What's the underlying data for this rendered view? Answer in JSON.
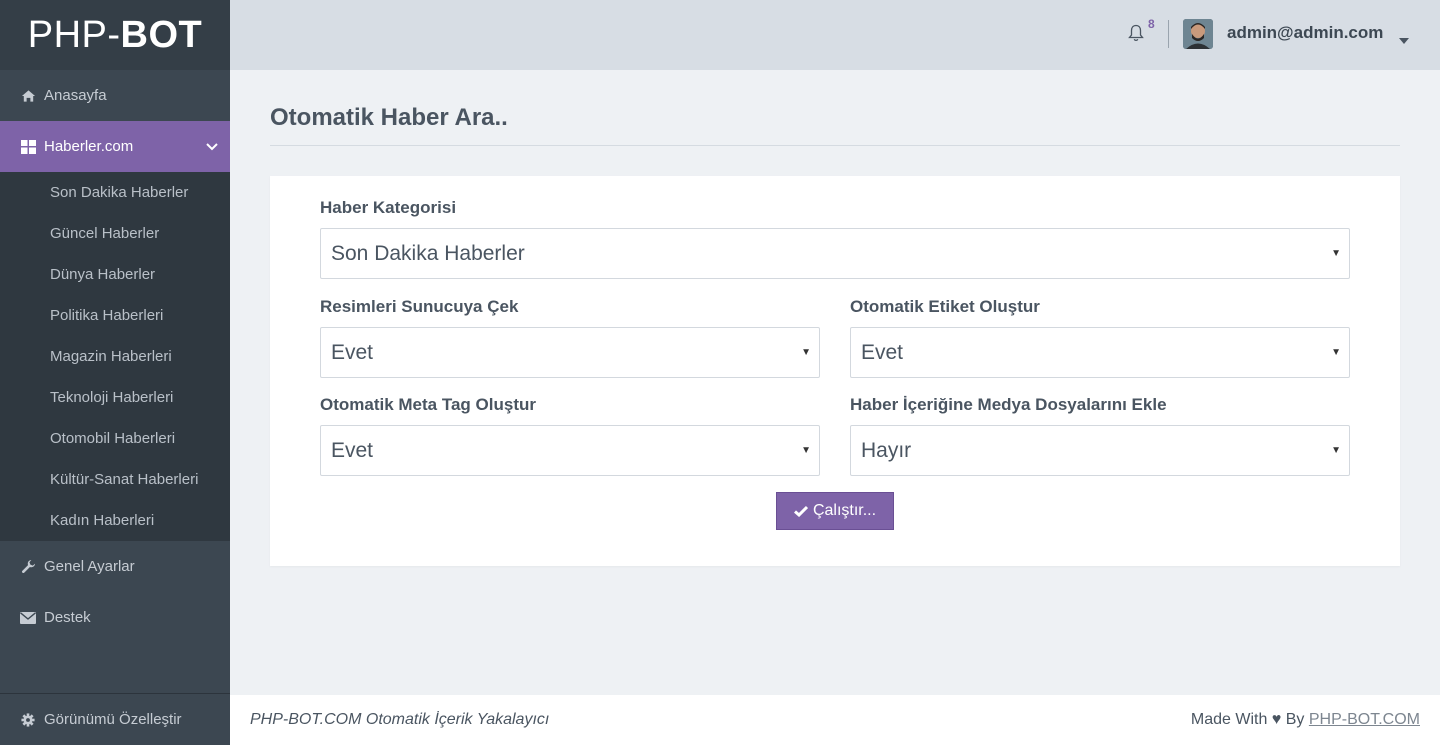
{
  "brand": {
    "prefix": "PHP-",
    "bold": "BOT"
  },
  "sidebar": {
    "items": [
      {
        "label": "Anasayfa",
        "icon": "home-icon"
      },
      {
        "label": "Haberler.com",
        "icon": "grid-icon"
      },
      {
        "label": "Genel Ayarlar",
        "icon": "wrench-icon"
      },
      {
        "label": "Destek",
        "icon": "envelope-icon"
      }
    ],
    "submenu": [
      "Son Dakika Haberler",
      "Güncel Haberler",
      "Dünya Haberler",
      "Politika Haberleri",
      "Magazin Haberleri",
      "Teknoloji Haberleri",
      "Otomobil Haberleri",
      "Kültür-Sanat Haberleri",
      "Kadın Haberleri"
    ],
    "footer_label": "Görünümü Özelleştir",
    "footer_icon": "gear-icon"
  },
  "topbar": {
    "notification_count": "8",
    "user_email": "admin@admin.com"
  },
  "page": {
    "title": "Otomatik Haber Ara..",
    "fields": {
      "category": {
        "label": "Haber Kategorisi",
        "value": "Son Dakika Haberler"
      },
      "fetch_images": {
        "label": "Resimleri Sunucuya Çek",
        "value": "Evet"
      },
      "auto_tags": {
        "label": "Otomatik Etiket Oluştur",
        "value": "Evet"
      },
      "auto_meta": {
        "label": "Otomatik Meta Tag Oluştur",
        "value": "Evet"
      },
      "media_files": {
        "label": "Haber İçeriğine Medya Dosyalarını Ekle",
        "value": "Hayır"
      }
    },
    "run_button": "Çalıştır..."
  },
  "footer": {
    "left": "PHP-BOT.COM Otomatik İçerik Yakalayıcı",
    "made_with": "Made With",
    "heart": "♥",
    "by": "By",
    "link": "PHP-BOT.COM"
  },
  "colors": {
    "accent": "#7e63a8",
    "sidebar": "#3c4751",
    "submenu": "#2f3840",
    "topbar": "#d7dde4"
  }
}
